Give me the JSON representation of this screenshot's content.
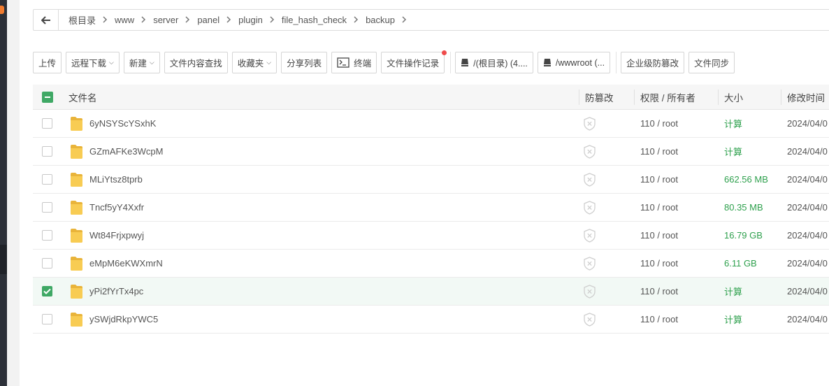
{
  "breadcrumb": {
    "items": [
      "根目录",
      "www",
      "server",
      "panel",
      "plugin",
      "file_hash_check",
      "backup"
    ]
  },
  "toolbar": {
    "upload": "上传",
    "remote_download": "远程下载",
    "new": "新建",
    "content_search": "文件内容查找",
    "favorites": "收藏夹",
    "share_list": "分享列表",
    "terminal": "终端",
    "op_log": "文件操作记录",
    "disk_root": "/(根目录) (4....",
    "disk_www": "/wwwroot (...",
    "enterprise_protect": "企业级防篡改",
    "file_sync": "文件同步"
  },
  "table": {
    "headers": {
      "name": "文件名",
      "protect": "防篡改",
      "perm": "权限 / 所有者",
      "size": "大小",
      "time": "修改时间"
    },
    "rows": [
      {
        "name": "6yNSYScYSxhK",
        "perm": "110 / root",
        "size": "计算",
        "size_is_calc": true,
        "time": "2024/04/0",
        "checked": false
      },
      {
        "name": "GZmAFKe3WcpM",
        "perm": "110 / root",
        "size": "计算",
        "size_is_calc": true,
        "time": "2024/04/0",
        "checked": false
      },
      {
        "name": "MLiYtsz8tprb",
        "perm": "110 / root",
        "size": "662.56 MB",
        "size_is_calc": false,
        "time": "2024/04/0",
        "checked": false
      },
      {
        "name": "Tncf5yY4Xxfr",
        "perm": "110 / root",
        "size": "80.35 MB",
        "size_is_calc": false,
        "time": "2024/04/0",
        "checked": false
      },
      {
        "name": "Wt84Frjxpwyj",
        "perm": "110 / root",
        "size": "16.79 GB",
        "size_is_calc": false,
        "time": "2024/04/0",
        "checked": false
      },
      {
        "name": "eMpM6eKWXmrN",
        "perm": "110 / root",
        "size": "6.11 GB",
        "size_is_calc": false,
        "time": "2024/04/0",
        "checked": false
      },
      {
        "name": "yPi2fYrTx4pc",
        "perm": "110 / root",
        "size": "计算",
        "size_is_calc": true,
        "time": "2024/04/0",
        "checked": true
      },
      {
        "name": "ySWjdRkpYWC5",
        "perm": "110 / root",
        "size": "计算",
        "size_is_calc": true,
        "time": "2024/04/0",
        "checked": false
      }
    ]
  },
  "colors": {
    "accent_green": "#3fa865",
    "size_green": "#2ea04d",
    "notify_red": "#ef4b4b",
    "folder_yellow": "#f5c342"
  }
}
